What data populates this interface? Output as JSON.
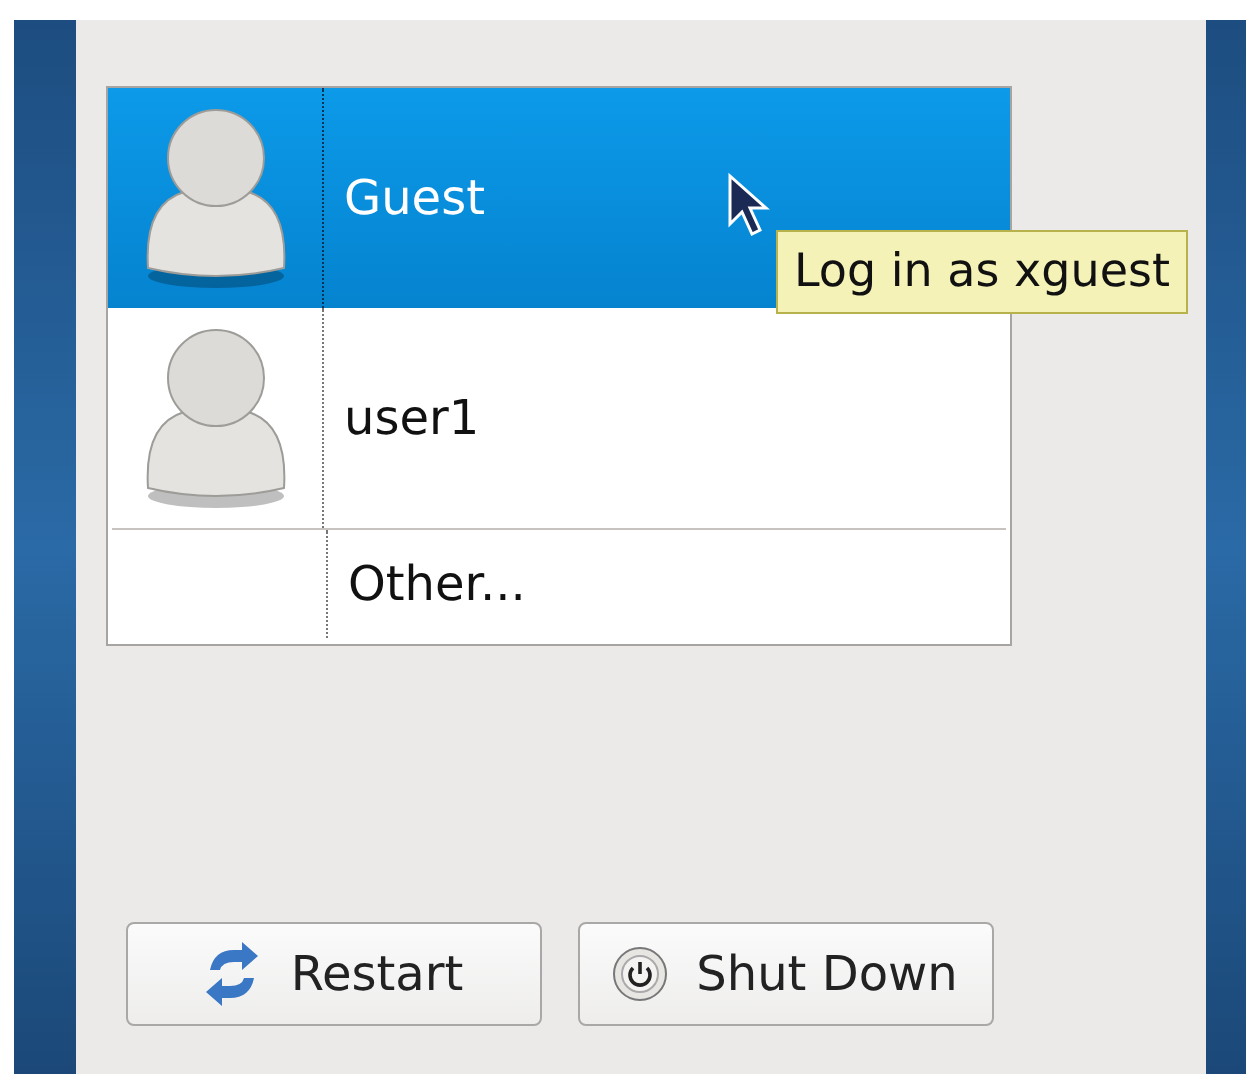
{
  "users": [
    {
      "name": "Guest",
      "kind": "user",
      "selected": true
    },
    {
      "name": "user1",
      "kind": "user",
      "selected": false
    },
    {
      "name": "Other...",
      "kind": "other",
      "selected": false
    }
  ],
  "tooltip": {
    "text": "Log in as xguest"
  },
  "buttons": [
    {
      "label": "Restart",
      "kind": "restart"
    },
    {
      "label": "Shut Down",
      "kind": "power"
    }
  ]
}
